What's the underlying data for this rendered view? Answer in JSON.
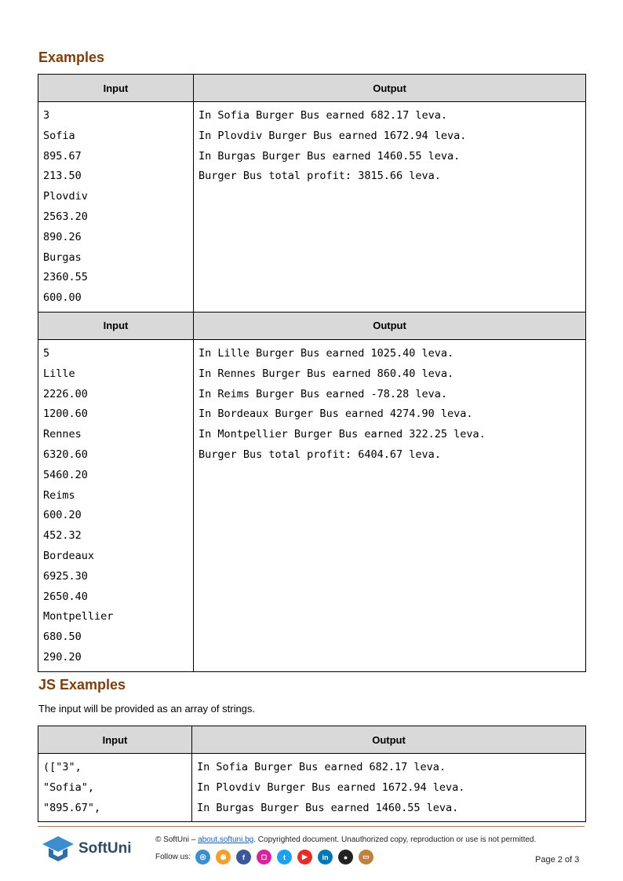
{
  "sections": {
    "examples_title": "Examples",
    "js_examples_title": "JS Examples",
    "js_note": "The input will be provided as an array of strings."
  },
  "table_headers": {
    "input": "Input",
    "output": "Output"
  },
  "example1": {
    "input": [
      "3",
      "Sofia",
      "895.67",
      "213.50",
      "Plovdiv",
      "2563.20",
      "890.26",
      "Burgas",
      "2360.55",
      "600.00"
    ],
    "output": [
      "In Sofia Burger Bus earned 682.17 leva.",
      "In Plovdiv Burger Bus earned 1672.94 leva.",
      "In Burgas Burger Bus earned 1460.55 leva.",
      "Burger Bus total profit: 3815.66 leva."
    ]
  },
  "example2": {
    "input": [
      "5",
      "Lille",
      "2226.00",
      "1200.60",
      "Rennes",
      "6320.60",
      "5460.20",
      "Reims",
      "600.20",
      "452.32",
      "Bordeaux",
      "6925.30",
      "2650.40",
      "Montpellier",
      "680.50",
      "290.20"
    ],
    "output": [
      "In Lille Burger Bus earned 1025.40 leva.",
      "In Rennes Burger Bus earned 860.40 leva.",
      "In Reims Burger Bus earned -78.28 leva.",
      "In Bordeaux Burger Bus earned 4274.90 leva.",
      "In Montpellier Burger Bus earned 322.25 leva.",
      "Burger Bus total profit: 6404.67 leva."
    ]
  },
  "js_example": {
    "input": [
      "([\"3\",",
      "\"Sofia\",",
      "\"895.67\","
    ],
    "output": [
      "In Sofia Burger Bus earned 682.17 leva.",
      "In Plovdiv Burger Bus earned 1672.94 leva.",
      "In Burgas Burger Bus earned 1460.55 leva."
    ]
  },
  "footer": {
    "copyright_prefix": "© SoftUni – ",
    "link_text": "about.softuni.bg",
    "copyright_suffix": ". Copyrighted document. Unauthorized copy, reproduction or use is not permitted.",
    "follow_label": "Follow us:",
    "page_label": "Page 2 of 3",
    "logo_text": "SoftUni",
    "social_icons": [
      {
        "name": "softuni-icon",
        "color": "#3b8fd0",
        "glyph": "◎"
      },
      {
        "name": "softuni-foundation-icon",
        "color": "#f0a030",
        "glyph": "◉"
      },
      {
        "name": "facebook-icon",
        "color": "#3b5998",
        "glyph": "f"
      },
      {
        "name": "instagram-icon",
        "color": "#d6249f",
        "glyph": "◻"
      },
      {
        "name": "twitter-icon",
        "color": "#1da1f2",
        "glyph": "t"
      },
      {
        "name": "youtube-icon",
        "color": "#e52d27",
        "glyph": "▶"
      },
      {
        "name": "linkedin-icon",
        "color": "#0077b5",
        "glyph": "in"
      },
      {
        "name": "github-icon",
        "color": "#222222",
        "glyph": "●"
      },
      {
        "name": "softuni-blog-icon",
        "color": "#c08040",
        "glyph": "▭"
      }
    ]
  }
}
